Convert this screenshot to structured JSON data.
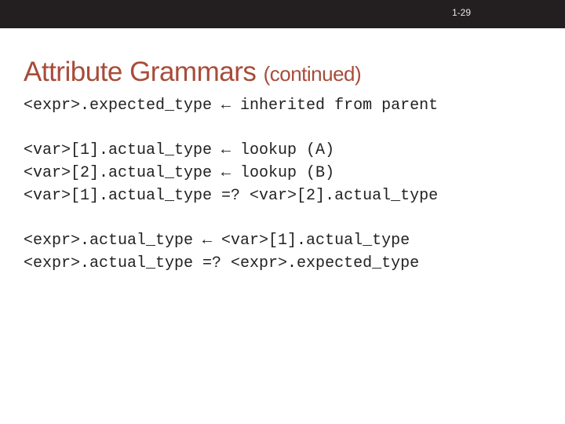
{
  "header": {
    "page_number": "1-29"
  },
  "title": {
    "main": "Attribute Grammars",
    "sub": "(continued)"
  },
  "lines": {
    "l1": "<expr>.expected_type ← inherited from parent",
    "l2": "<var>[1].actual_type ← lookup (A)",
    "l3": "<var>[2].actual_type ← lookup (B)",
    "l4": "<var>[1].actual_type =? <var>[2].actual_type",
    "l5": "<expr>.actual_type ← <var>[1].actual_type",
    "l6": "<expr>.actual_type =? <expr>.expected_type"
  }
}
